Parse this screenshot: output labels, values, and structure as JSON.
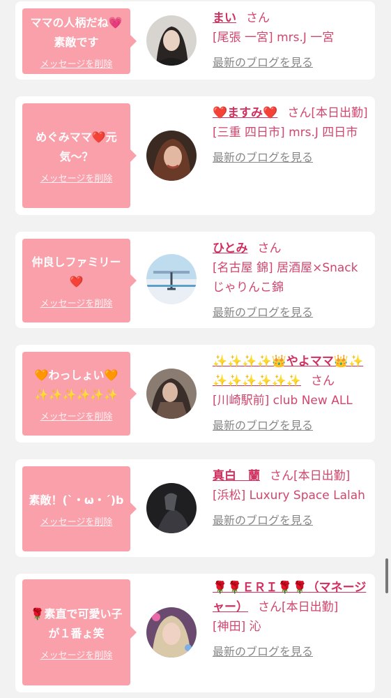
{
  "cards": [
    {
      "message": "ママの人柄だね💗素敵です",
      "delete_label": "メッセージを削除",
      "name": "まい",
      "suffix": "さん",
      "place": "[尾張 一宮] mrs.J 一宮",
      "blog_link": "最新のブログを見る"
    },
    {
      "message": "めぐみママ❤️元気〜？",
      "delete_label": "メッセージを削除",
      "name": "❤️ますみ❤️",
      "suffix": "さん[本日出勤]",
      "place": "[三重 四日市] mrs.J 四日市",
      "blog_link": "最新のブログを見る"
    },
    {
      "message": "仲良しファミリー❤️",
      "delete_label": "メッセージを削除",
      "name": "ひとみ",
      "suffix": "さん",
      "place": "[名古屋 錦] 居酒屋×Snack じゃりんこ錦",
      "blog_link": "最新のブログを見る"
    },
    {
      "message": "🧡わっしょい🧡✨✨✨✨✨✨",
      "delete_label": "メッセージを削除",
      "name": "✨✨✨✨👑やよママ👑✨✨✨✨✨✨✨",
      "suffix": "さん",
      "place": "[川崎駅前] club New ALL",
      "blog_link": "最新のブログを見る"
    },
    {
      "message": "素敵！(ˋ・ω・ˊ)b",
      "delete_label": "メッセージを削除",
      "name": "真白　蘭",
      "suffix": "さん[本日出勤]",
      "place": "[浜松] Luxury Space Lalah",
      "blog_link": "最新のブログを見る"
    },
    {
      "message": "🌹素直で可愛い子が１番ょ笑",
      "delete_label": "メッセージを削除",
      "name": "🌹🌹ＥＲＩ🌹🌹（マネージャー）",
      "suffix": "さん[本日出勤]",
      "place": "[神田] 沁",
      "blog_link": "最新のブログを見る"
    }
  ]
}
